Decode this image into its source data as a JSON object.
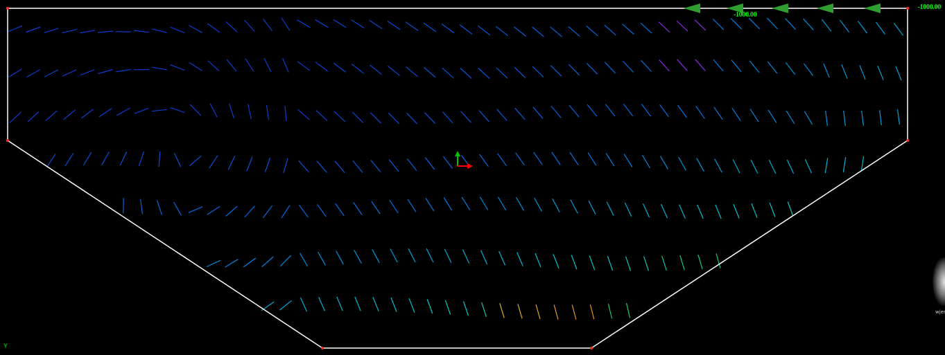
{
  "viewport": {
    "background": "#000000",
    "boundary_color": "#ffffff",
    "node_color": "#ff3030"
  },
  "loads": {
    "label_right": "-1000.00",
    "label_mid": "-1000.00",
    "arrow_count": 5,
    "arrow_color": "#2e9e2e",
    "direction": "left"
  },
  "axes": {
    "x_color": "#ff0000",
    "y_color": "#00c000",
    "y_label": "Y"
  },
  "vector_field": {
    "rows": 7,
    "color_map": [
      "blue-low",
      "cyan",
      "green",
      "yellow",
      "orange",
      "red-high",
      "purple"
    ]
  },
  "edge_note": "wjer"
}
